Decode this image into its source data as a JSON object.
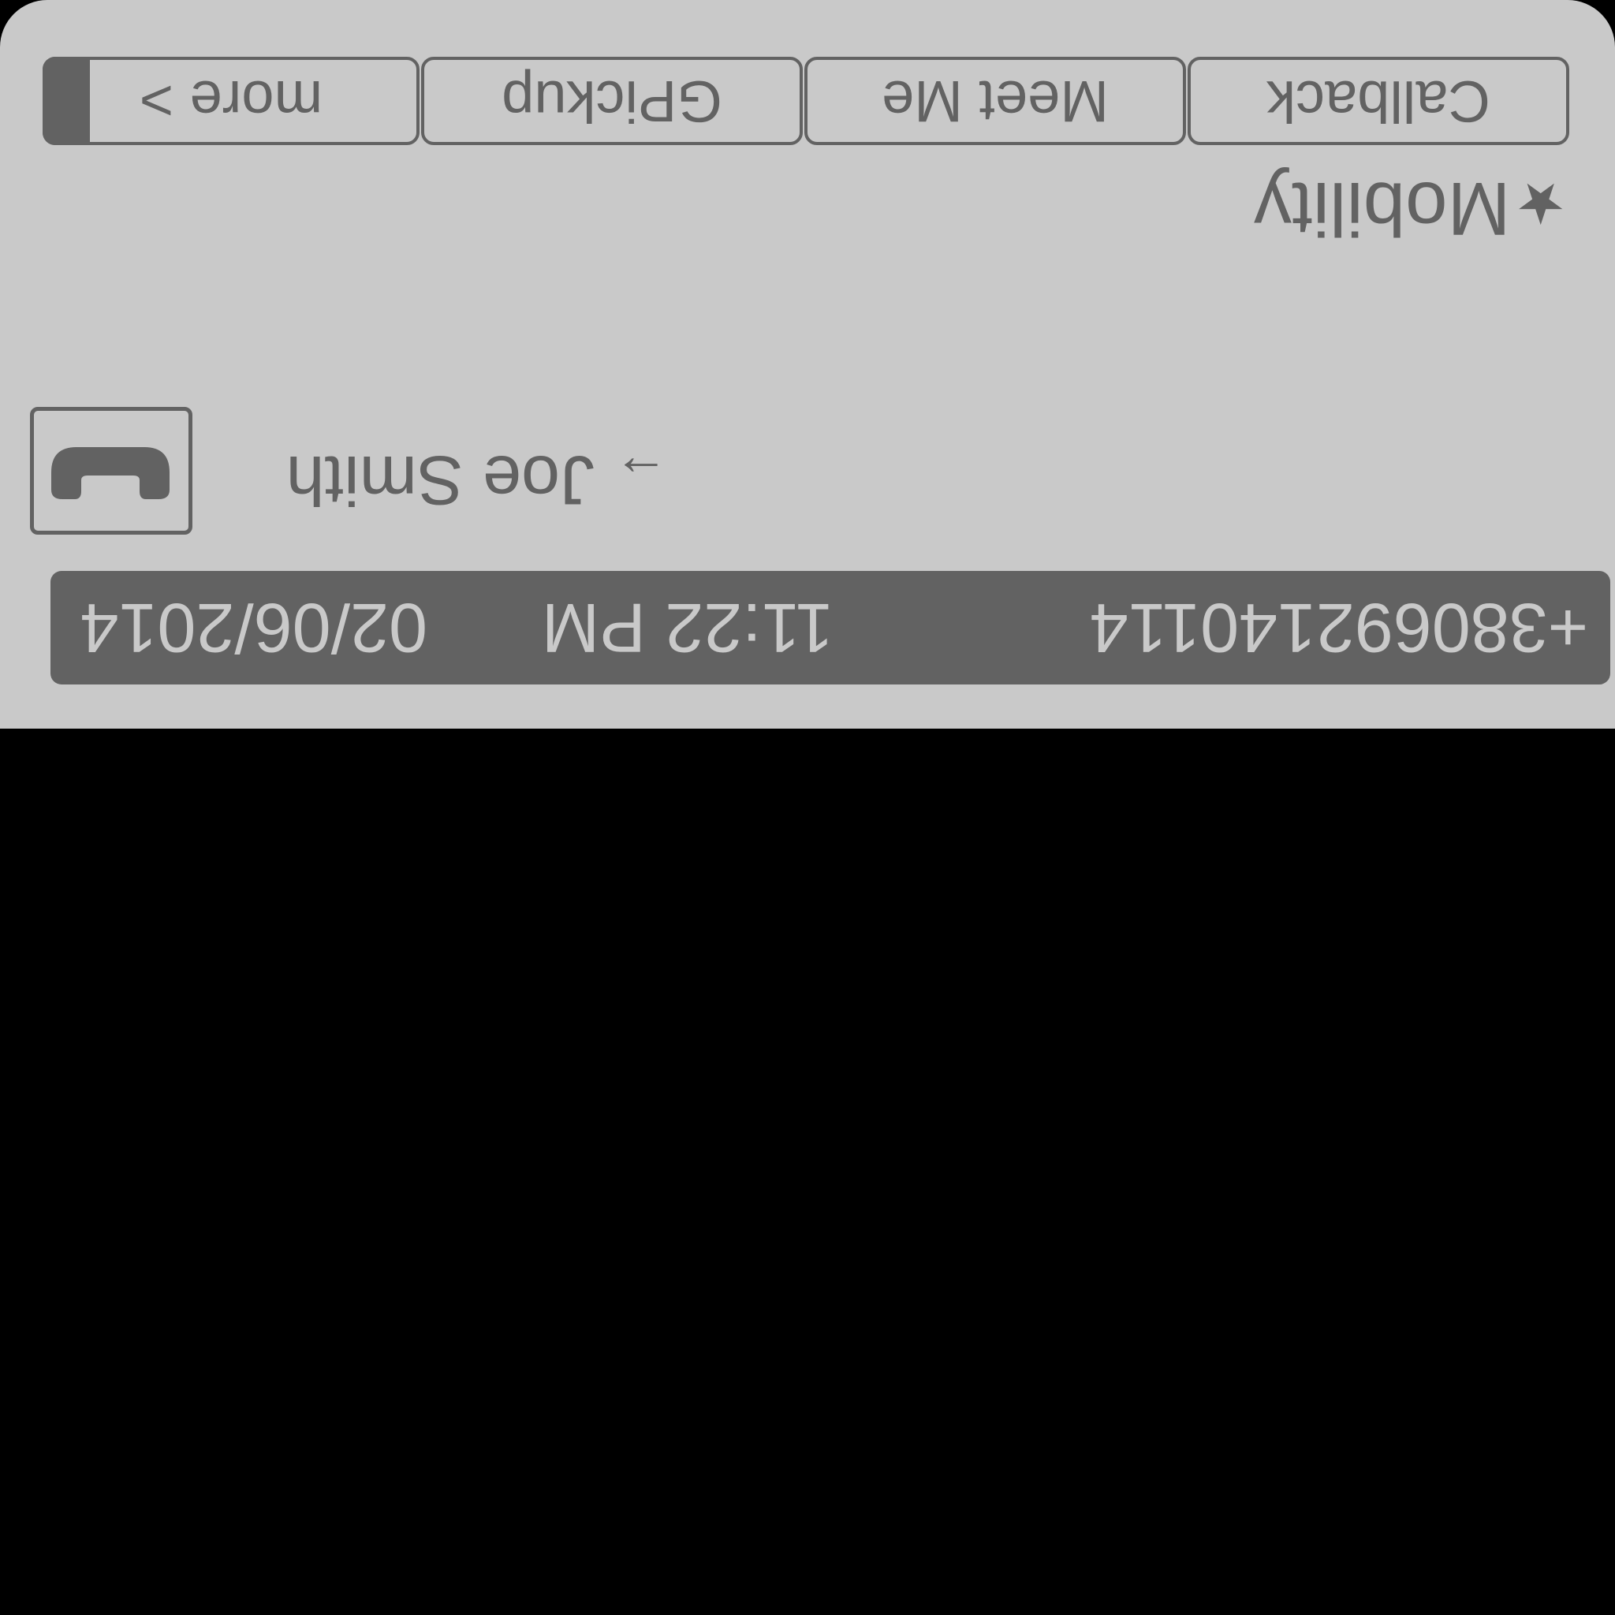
{
  "status_bar": {
    "date": "02/06/2014",
    "time": "11:22 PM",
    "phone_number": "+380692140114"
  },
  "line": {
    "label": "Joe Smith",
    "key_icon": "handset-icon",
    "indicator_icon": "arrow-icon"
  },
  "mobility": {
    "label": "Mobility",
    "icon": "star-icon"
  },
  "softkeys": [
    {
      "label": "Callback"
    },
    {
      "label": "Meet Me"
    },
    {
      "label": "GPickup"
    },
    {
      "label": "more >"
    }
  ],
  "colors": {
    "screen_background": "#c9c9c9",
    "foreground": "#626262",
    "outside": "#000000"
  }
}
